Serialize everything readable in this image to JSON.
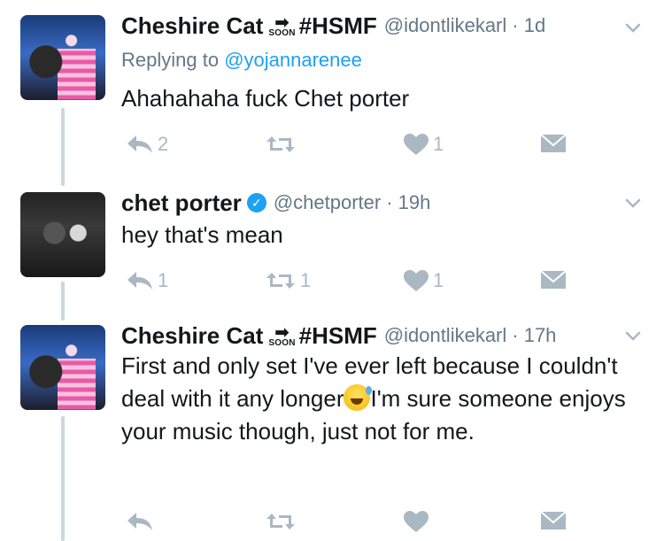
{
  "tweets": [
    {
      "name": "Cheshire Cat",
      "soon_badge": "SOON",
      "hashtag": "#HSMF",
      "handle": "@idontlikekarl",
      "time": "· 1d",
      "replying_prefix": "Replying to ",
      "replying_handle": "@yojannarenee",
      "text": "Ahahahaha fuck Chet porter",
      "counts": {
        "reply": "2",
        "retweet": "",
        "like": "1"
      }
    },
    {
      "name": "chet porter",
      "handle": "@chetporter",
      "time": "· 19h",
      "verified": true,
      "text": "hey that's mean",
      "counts": {
        "reply": "1",
        "retweet": "1",
        "like": "1"
      }
    },
    {
      "name": "Cheshire Cat",
      "soon_badge": "SOON",
      "hashtag": "#HSMF",
      "handle": "@idontlikekarl",
      "time": "· 17h",
      "text_part1": "First and only set I've ever left because I couldn't deal with it any longer",
      "text_part2": "I'm sure someone enjoys your music though, just not for me.",
      "counts": {
        "reply": "",
        "retweet": "",
        "like": ""
      }
    }
  ],
  "icons": {
    "reply": "reply-icon",
    "retweet": "retweet-icon",
    "like": "heart-icon",
    "dm": "envelope-icon",
    "caret": "chevron-down-icon",
    "verified": "verified-badge-icon",
    "emoji": "grinning-sweat-emoji"
  },
  "colors": {
    "text": "#14171a",
    "muted": "#657786",
    "link": "#1da1f2",
    "icon": "#aab8c2",
    "thread_line": "#ccd6dd"
  }
}
